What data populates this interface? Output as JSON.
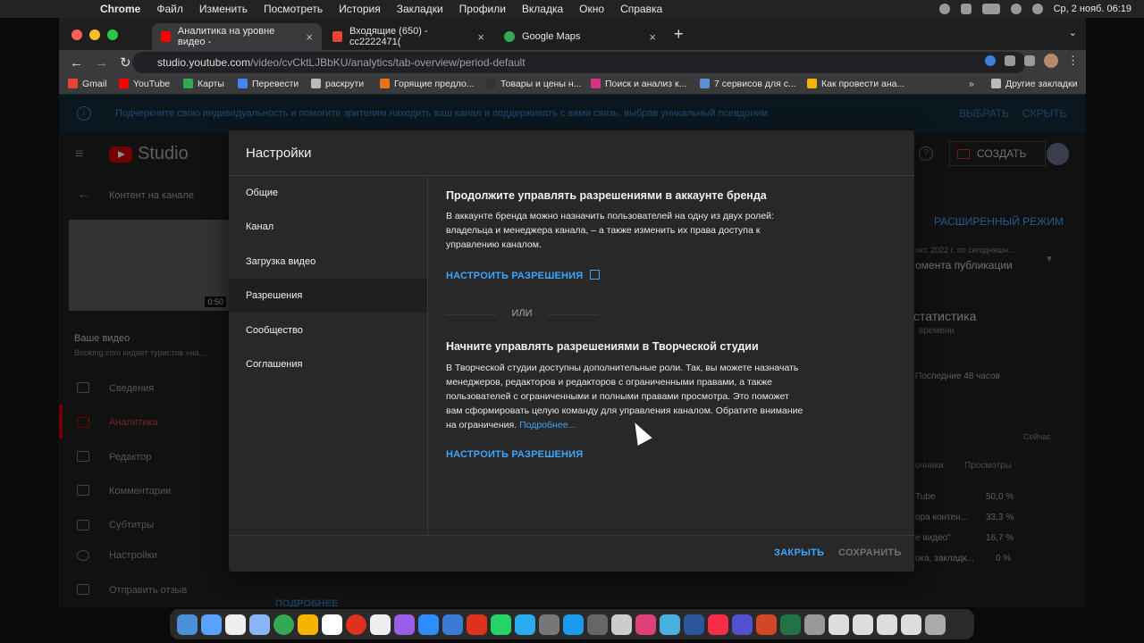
{
  "menubar": {
    "app": "Chrome",
    "items": [
      "Файл",
      "Изменить",
      "Посмотреть",
      "История",
      "Закладки",
      "Профили",
      "Вкладка",
      "Окно",
      "Справка"
    ],
    "clock": "Ср, 2 нояб. 06:19"
  },
  "tabs": [
    {
      "label": "Аналитика на уровне видео -",
      "active": true
    },
    {
      "label": "Входящие (650) - cc2222471(",
      "active": false
    },
    {
      "label": "Google Maps",
      "active": false
    }
  ],
  "address": {
    "host": "studio.youtube.com",
    "path": "/video/cvCktLJBbKU/analytics/tab-overview/period-default"
  },
  "bookmarks": [
    "Gmail",
    "YouTube",
    "Карты",
    "Перевести",
    "раскрути",
    "Горящие предло...",
    "Товары и цены н...",
    "Поиск и анализ к...",
    "7 сервисов для с...",
    "Как провести ана...",
    "Другие закладки"
  ],
  "banner": {
    "message": "Подчеркните свою индивидуальность и помогите зрителям находить ваш канал и поддерживать с вами связь, выбрав уникальный псевдоним",
    "choose": "ВЫБРАТЬ",
    "hide": "СКРЫТЬ"
  },
  "studio": {
    "logo": "Studio",
    "create": "СОЗДАТЬ",
    "back_label": "Контент на канале",
    "video_duration": "0:50",
    "your_video": "Ваше видео",
    "video_subtitle": "Booking.com кидает туристов «на...",
    "nav": [
      "Сведения",
      "Аналитика",
      "Редактор",
      "Комментарии",
      "Субтитры",
      "Настройки",
      "Отправить отзыв"
    ],
    "advanced": "РАСШИРЕННЫЙ РЕЖИМ",
    "period": "окт. 2022 г. по сегодняшн...",
    "period2": "омента публикации",
    "stat_title": "статистика",
    "stat_sub": "времени",
    "last48": "Последние 48 часов",
    "now": "Сейчас",
    "col_src": "очники",
    "col_views": "Просмотры",
    "rows": [
      {
        "src": "Tube",
        "pct": "50,0 %"
      },
      {
        "src": "ора контен...",
        "pct": "33,3 %"
      },
      {
        "src": "е видео\"",
        "pct": "16,7 %"
      },
      {
        "src": "ока, закладк...",
        "pct": "0 %"
      }
    ],
    "more_bottom": "ПОДРОБНЕЕ"
  },
  "modal": {
    "title": "Настройки",
    "nav": [
      "Общие",
      "Канал",
      "Загрузка видео",
      "Разрешения",
      "Сообщество",
      "Соглашения"
    ],
    "selected": "Разрешения",
    "sec1_title": "Продолжите управлять разрешениями в аккаунте бренда",
    "sec1_lines": [
      "В аккаунте бренда можно назначить пользователей на одну из двух ролей:",
      "владельца и менеджера канала, – а также изменить их права доступа к",
      "управлению каналом."
    ],
    "sec1_link": "НАСТРОИТЬ РАЗРЕШЕНИЯ",
    "or": "ИЛИ",
    "sec2_title": "Начните управлять разрешениями в Творческой студии",
    "sec2_lines": [
      "В Творческой студии доступны дополнительные роли. Так, вы можете назначать",
      "менеджеров, редакторов и редакторов с ограниченными правами, а также",
      "пользователей с ограниченными и полными правами просмотра. Это поможет",
      "вам сформировать целую команду для управления каналом. Обратите внимание"
    ],
    "sec2_last": "на ограничения.",
    "sec2_more": "Подробнее...",
    "sec2_link": "НАСТРОИТЬ РАЗРЕШЕНИЯ",
    "close": "ЗАКРЫТЬ",
    "save": "СОХРАНИТЬ"
  },
  "colors": {
    "accent": "#3ea6ff",
    "brand_red": "#cc0000",
    "modal_bg": "#282828"
  }
}
